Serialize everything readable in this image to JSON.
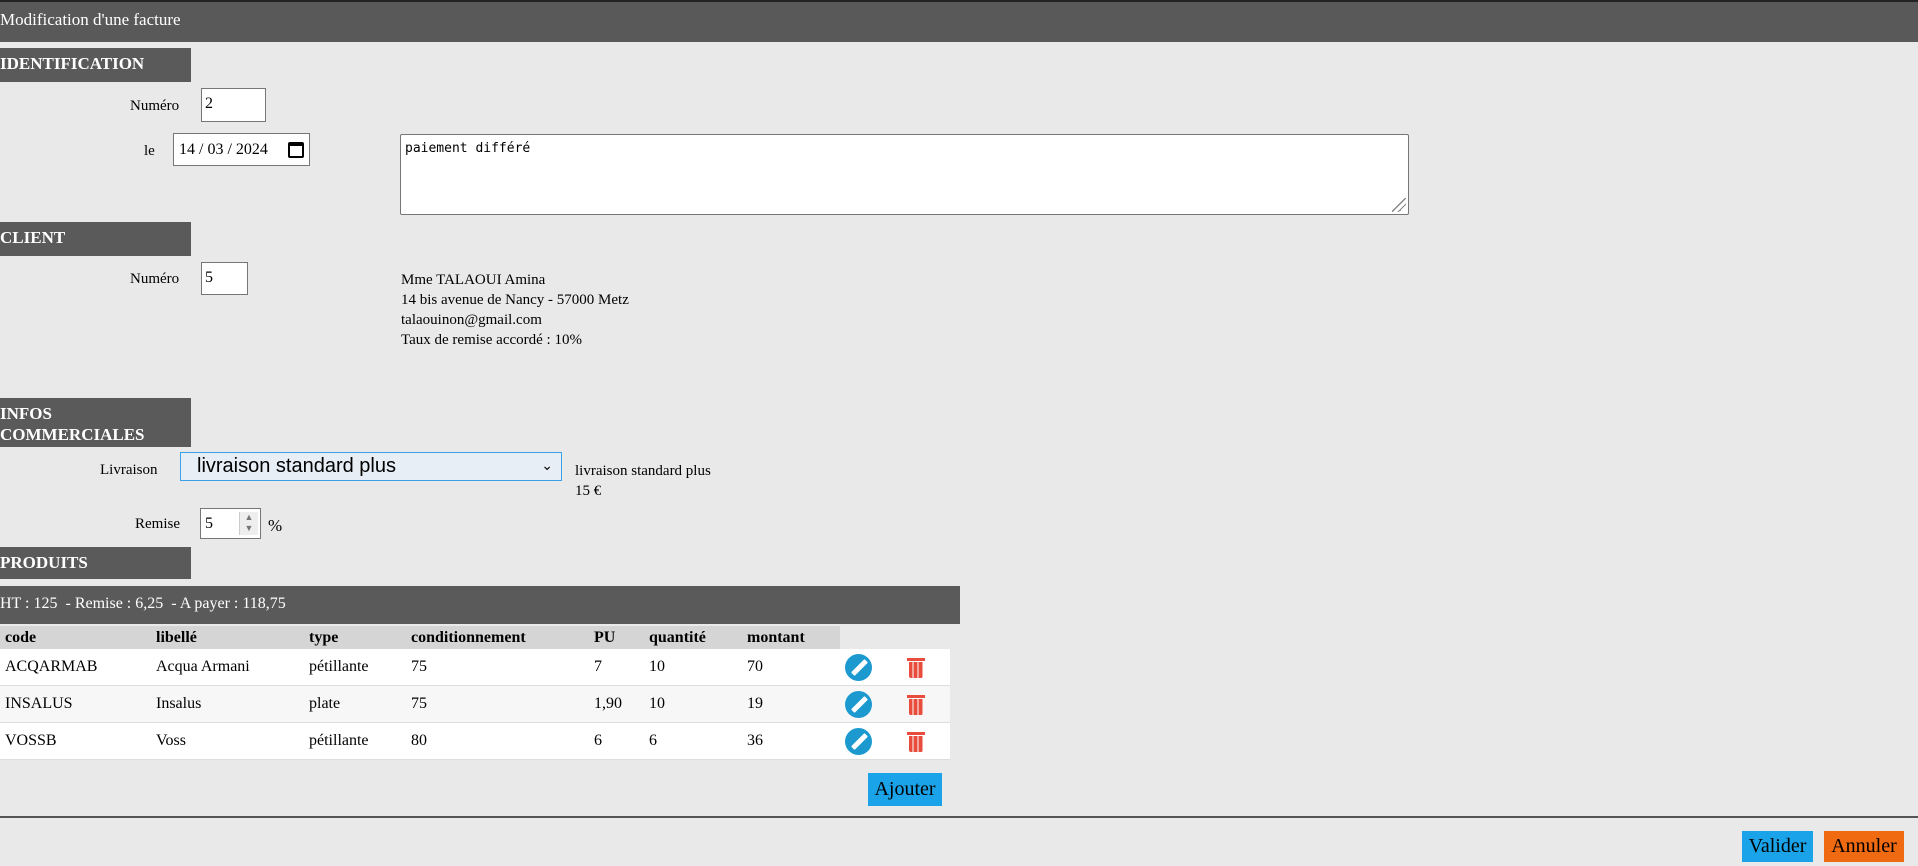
{
  "window": {
    "title": "Modification d'une facture"
  },
  "identification": {
    "header": "IDENTIFICATION",
    "numero_label": "Numéro",
    "numero_value": "2",
    "date_label": "le",
    "date_value": "14 / 03 / 2024",
    "comment": "paiement différé"
  },
  "client": {
    "header": "CLIENT",
    "numero_label": "Numéro",
    "numero_value": "5",
    "name": "Mme TALAOUI Amina",
    "address": "14 bis avenue de Nancy - 57000 Metz",
    "email": "talaouinon@gmail.com",
    "discount_rate": "Taux de remise accordé : 10%"
  },
  "infos": {
    "header_line1": "INFOS",
    "header_line2": "COMMERCIALES",
    "livraison_label": "Livraison",
    "livraison_selected": "livraison standard plus",
    "livraison_desc": "livraison standard plus",
    "livraison_price": "15 €",
    "remise_label": "Remise",
    "remise_value": "5",
    "remise_unit": "%"
  },
  "produits": {
    "header": "PRODUITS",
    "summary": "HT : 125  - Remise : 6,25  - A payer : 118,75",
    "columns": [
      "code",
      "libellé",
      "type",
      "conditionnement",
      "PU",
      "quantité",
      "montant"
    ],
    "rows": [
      [
        "ACQARMAB",
        "Acqua Armani",
        "pétillante",
        "75",
        "7",
        "10",
        "70"
      ],
      [
        "INSALUS",
        "Insalus",
        "plate",
        "75",
        "1,90",
        "10",
        "19"
      ],
      [
        "VOSSB",
        "Voss",
        "pétillante",
        "80",
        "6",
        "6",
        "36"
      ]
    ],
    "add_label": "Ajouter"
  },
  "actions": {
    "ok_label": "Valider",
    "cancel_label": "Annuler"
  },
  "colors": {
    "header_bg": "#5a5a5a",
    "page_bg": "#e9e9e9",
    "primary_button": "#1aa3e8",
    "cancel_button": "#f06a12",
    "edit_icon": "#1c9ad0",
    "delete_icon": "#e84c3d"
  },
  "icons": {
    "calendar": "calendar-icon",
    "edit": "pencil-icon",
    "delete": "trash-icon",
    "dropdown": "chevron-down-icon"
  }
}
